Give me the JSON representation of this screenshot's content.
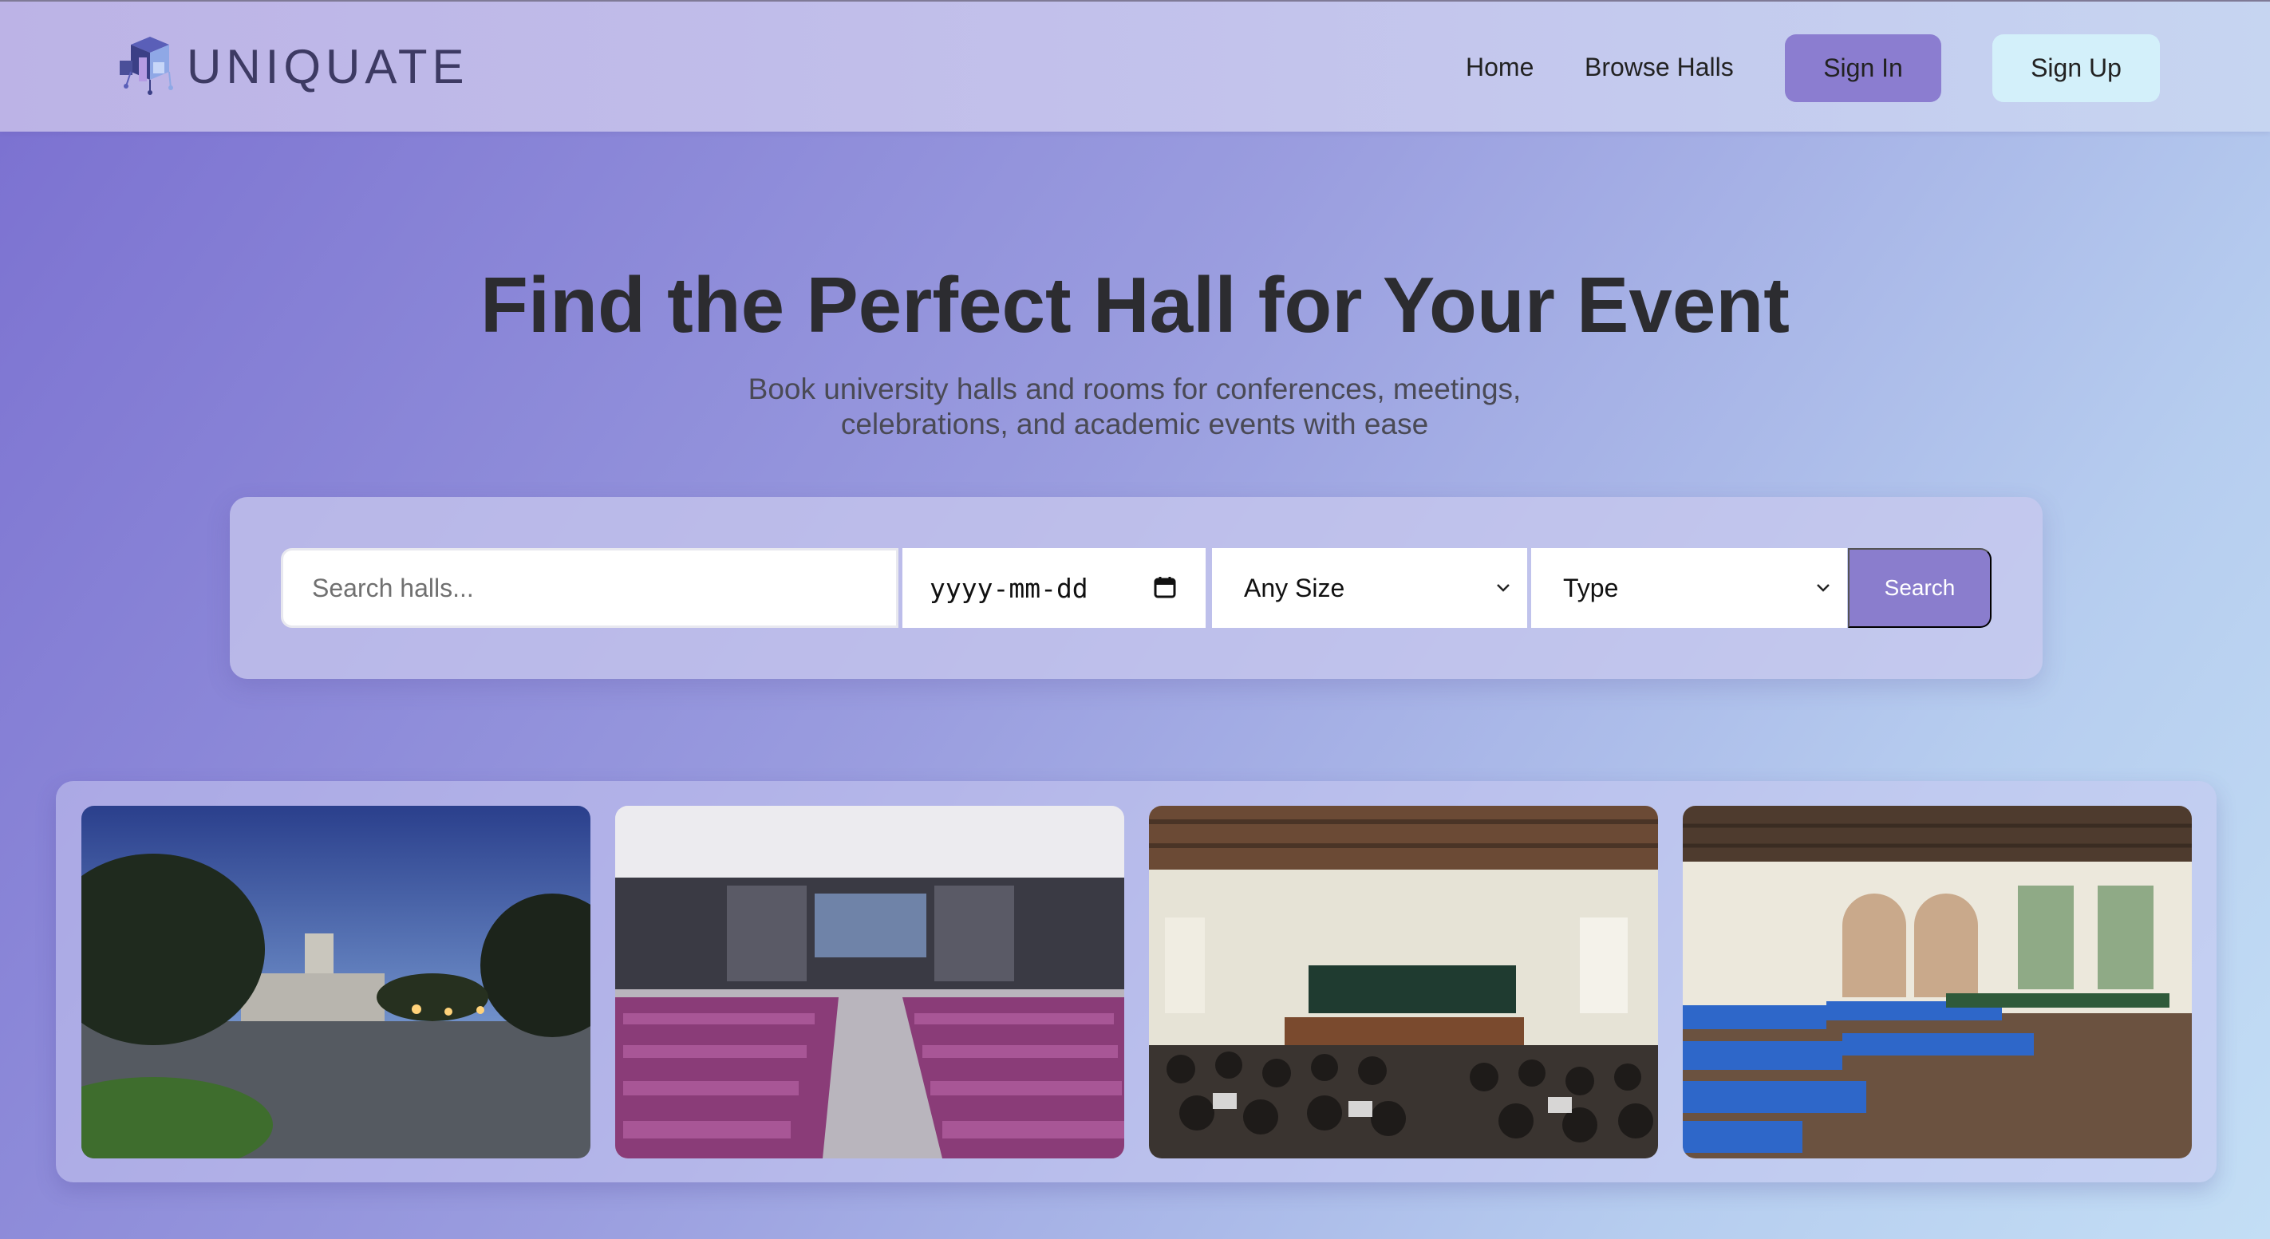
{
  "nav": {
    "logo_text": "UNIQUATE",
    "links": [
      "Home",
      "Browse Halls"
    ],
    "sign_in": "Sign In",
    "sign_up": "Sign Up"
  },
  "hero": {
    "title": "Find the Perfect Hall for Your Event",
    "subtitle_line1": "Book university halls and rooms for conferences, meetings,",
    "subtitle_line2": "celebrations, and academic events with ease"
  },
  "search": {
    "placeholder": "Search halls...",
    "date_placeholder": "yyyy-mm-dd",
    "size_selected": "Any Size",
    "type_selected": "Type",
    "button": "Search"
  },
  "gallery": {
    "images": [
      {
        "subject": "campus-night-building"
      },
      {
        "subject": "auditorium-purple-seats"
      },
      {
        "subject": "lecture-hall-students"
      },
      {
        "subject": "hall-blue-chairs"
      }
    ]
  },
  "colors": {
    "accent": "#8b7dd0",
    "signup_bg": "#d3f0fa",
    "title": "#2c2c30"
  }
}
